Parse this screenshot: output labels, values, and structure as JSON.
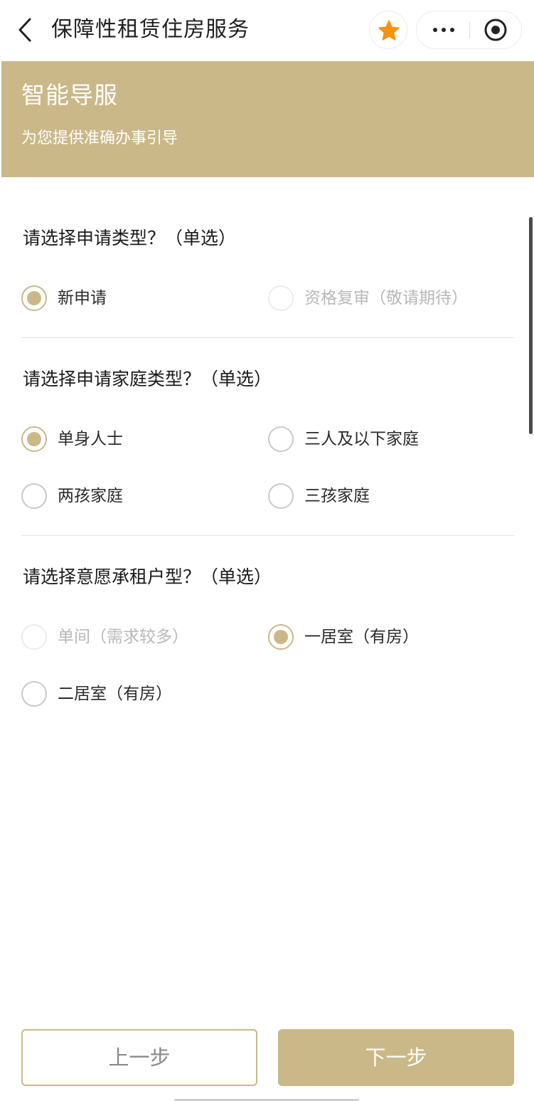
{
  "nav": {
    "title": "保障性租赁住房服务",
    "back_icon": "chevron-left-icon",
    "favorite_icon": "star-icon",
    "more_icon": "more-dots-icon",
    "close_icon": "target-circle-icon"
  },
  "banner": {
    "title": "智能导服",
    "subtitle": "为您提供准确办事引导"
  },
  "questions": [
    {
      "title": "请选择申请类型？（单选）",
      "options": [
        {
          "label": "新申请",
          "selected": true,
          "disabled": false
        },
        {
          "label": "资格复审（敬请期待）",
          "selected": false,
          "disabled": true
        }
      ]
    },
    {
      "title": "请选择申请家庭类型？（单选）",
      "options": [
        {
          "label": "单身人士",
          "selected": true,
          "disabled": false
        },
        {
          "label": "三人及以下家庭",
          "selected": false,
          "disabled": false
        },
        {
          "label": "两孩家庭",
          "selected": false,
          "disabled": false
        },
        {
          "label": "三孩家庭",
          "selected": false,
          "disabled": false
        }
      ]
    },
    {
      "title": "请选择意愿承租户型？（单选）",
      "options": [
        {
          "label": "单间（需求较多）",
          "selected": false,
          "disabled": true
        },
        {
          "label": "一居室（有房）",
          "selected": true,
          "disabled": false
        },
        {
          "label": "二居室（有房）",
          "selected": false,
          "disabled": false
        }
      ]
    }
  ],
  "buttons": {
    "prev": "上一步",
    "next": "下一步"
  },
  "colors": {
    "accent": "#cbb888",
    "star": "#f7930e",
    "disabled_text": "#b8b8b8"
  }
}
